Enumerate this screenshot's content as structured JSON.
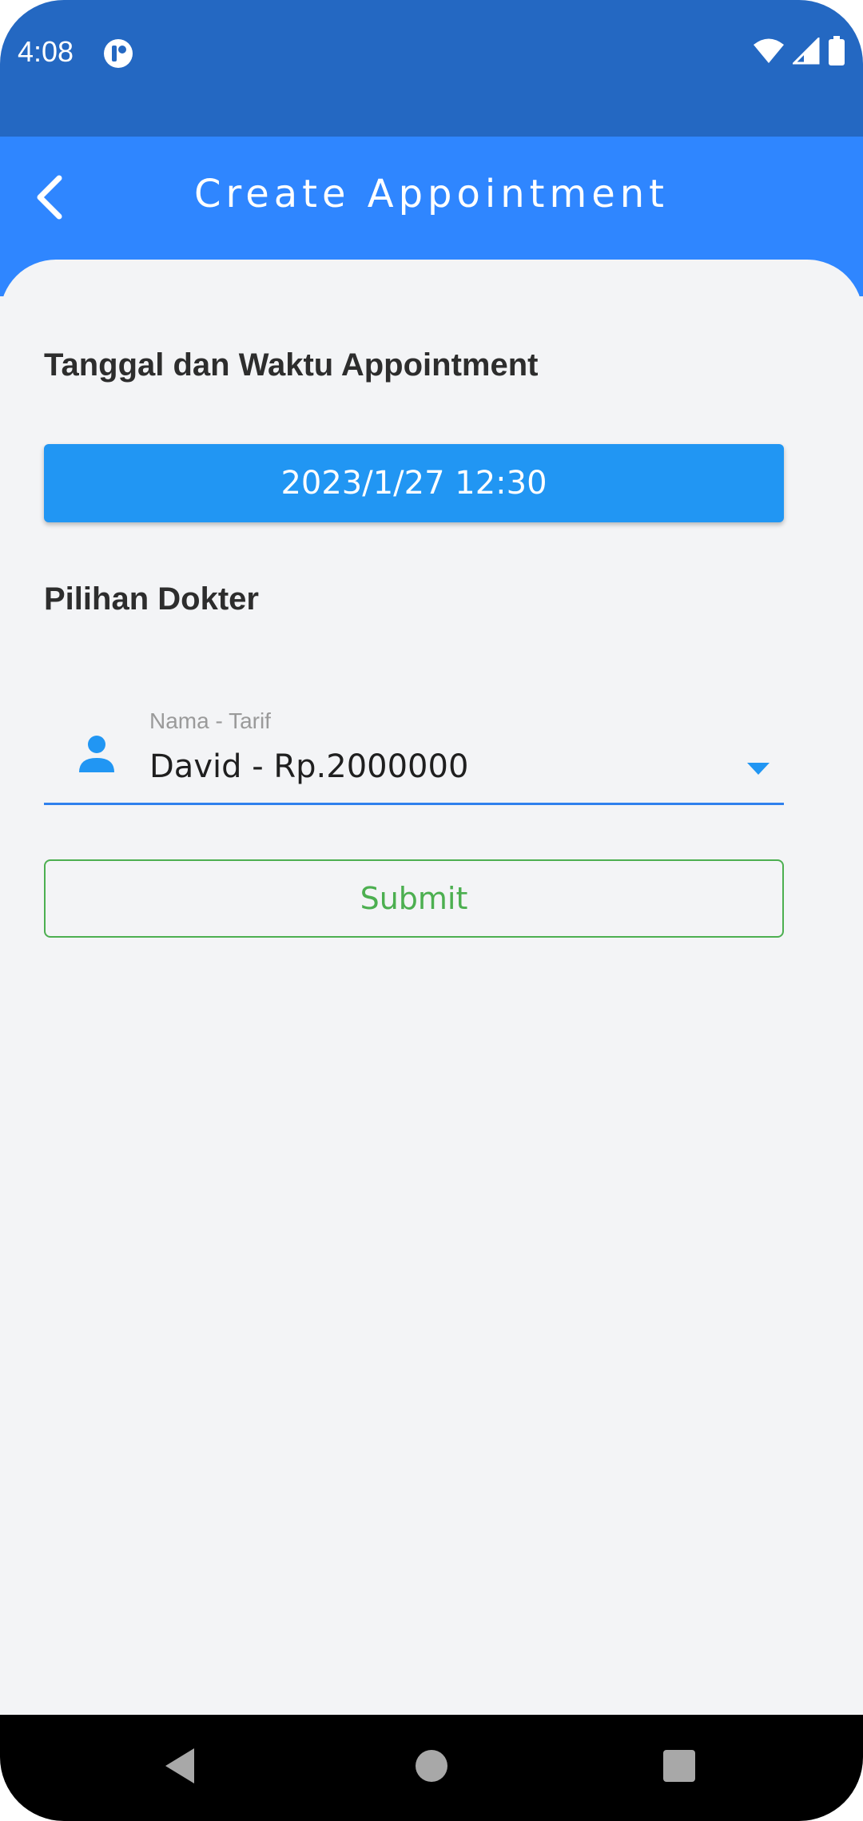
{
  "status_bar": {
    "time": "4:08",
    "app_icon": "notification-app-icon",
    "wifi_icon": "wifi-icon",
    "signal_icon": "cell-signal-icon",
    "battery_icon": "battery-icon"
  },
  "app_bar": {
    "title": "Create Appointment",
    "back_icon": "chevron-left-icon",
    "color": "#2F86FF"
  },
  "form": {
    "datetime_heading": "Tanggal dan Waktu Appointment",
    "datetime_value": "2023/1/27 12:30",
    "doctor_heading": "Pilihan Dokter",
    "doctor_field": {
      "label": "Nama - Tarif",
      "value": "David - Rp.2000000",
      "icon": "person-icon",
      "arrow_icon": "dropdown-arrow-icon"
    },
    "submit_label": "Submit"
  },
  "colors": {
    "status_bar": "#2468C2",
    "app_bar": "#2F86FF",
    "primary_button": "#2196F3",
    "submit": "#4CAF50",
    "background": "#F3F4F6"
  },
  "nav_bar": {
    "back_icon": "nav-back-icon",
    "home_icon": "nav-home-icon",
    "recents_icon": "nav-recents-icon"
  }
}
